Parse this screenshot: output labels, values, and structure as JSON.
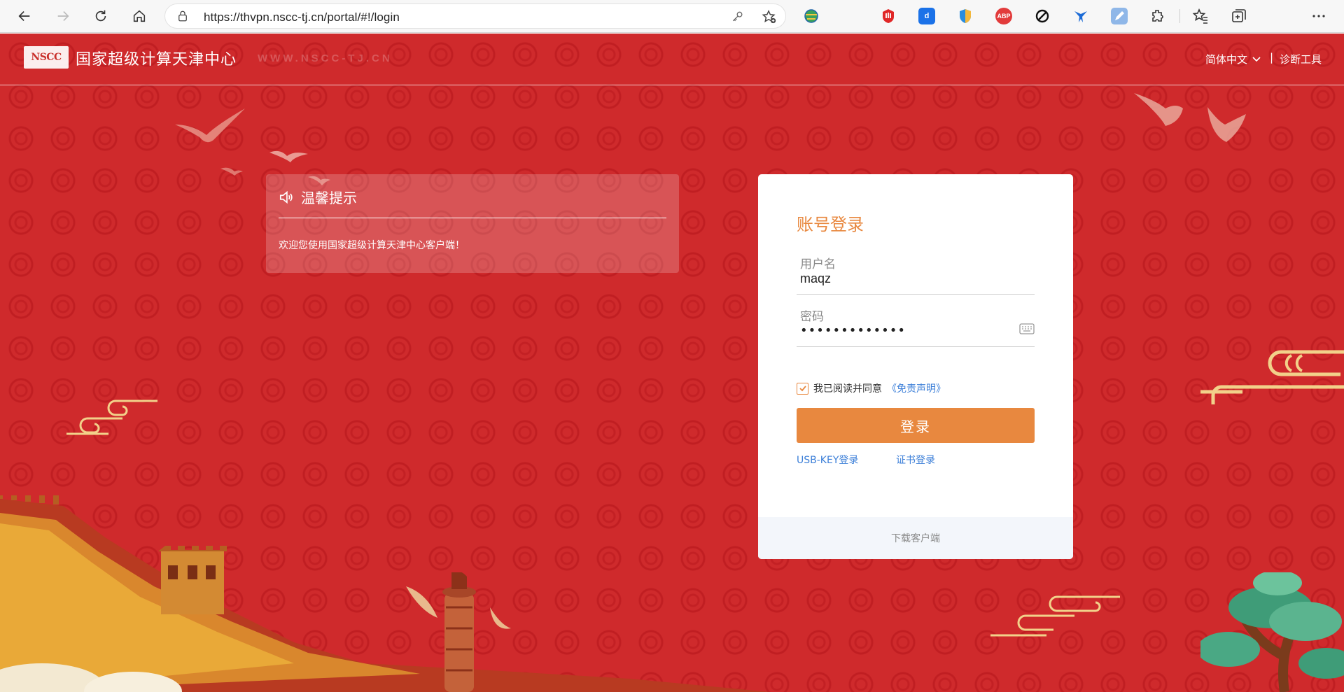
{
  "browser": {
    "url": "https://thvpn.nscc-tj.cn/portal/#!/login",
    "icons": [
      "back-icon",
      "forward-icon",
      "refresh-icon",
      "home-icon",
      "lock-icon",
      "key-icon",
      "favorite-add-icon"
    ],
    "extensions": [
      "globe-extension-icon",
      "red-hand-extension-icon",
      "blue-d-extension-icon",
      "shield-extension-icon",
      "abp-extension-icon",
      "block-extension-icon",
      "wing-extension-icon",
      "pen-extension-icon",
      "puzzle-icon",
      "favorites-icon",
      "collections-icon",
      "more-icon"
    ],
    "abp_label": "ABP"
  },
  "header": {
    "logo_text": "NSCC",
    "site_name": "国家超级计算天津中心",
    "site_url": "WWW.NSCC-TJ.CN",
    "language": "简体中文",
    "separator": "|",
    "diagnostic": "诊断工具"
  },
  "notice": {
    "title": "温馨提示",
    "message": "欢迎您使用国家超级计算天津中心客户端！"
  },
  "login": {
    "title": "账号登录",
    "username_label": "用户名",
    "username_value": "maqz",
    "password_label": "密码",
    "password_value": "•••••••••••••",
    "agree_text": "我已阅读并同意",
    "agree_link": "《免责声明》",
    "agree_checked": true,
    "submit_label": "登录",
    "usb_key_label": "USB-KEY登录",
    "cert_label": "证书登录",
    "download_label": "下载客户端"
  },
  "colors": {
    "background": "#cf2a2c",
    "accent": "#e8883f",
    "link": "#3c7fd8"
  }
}
